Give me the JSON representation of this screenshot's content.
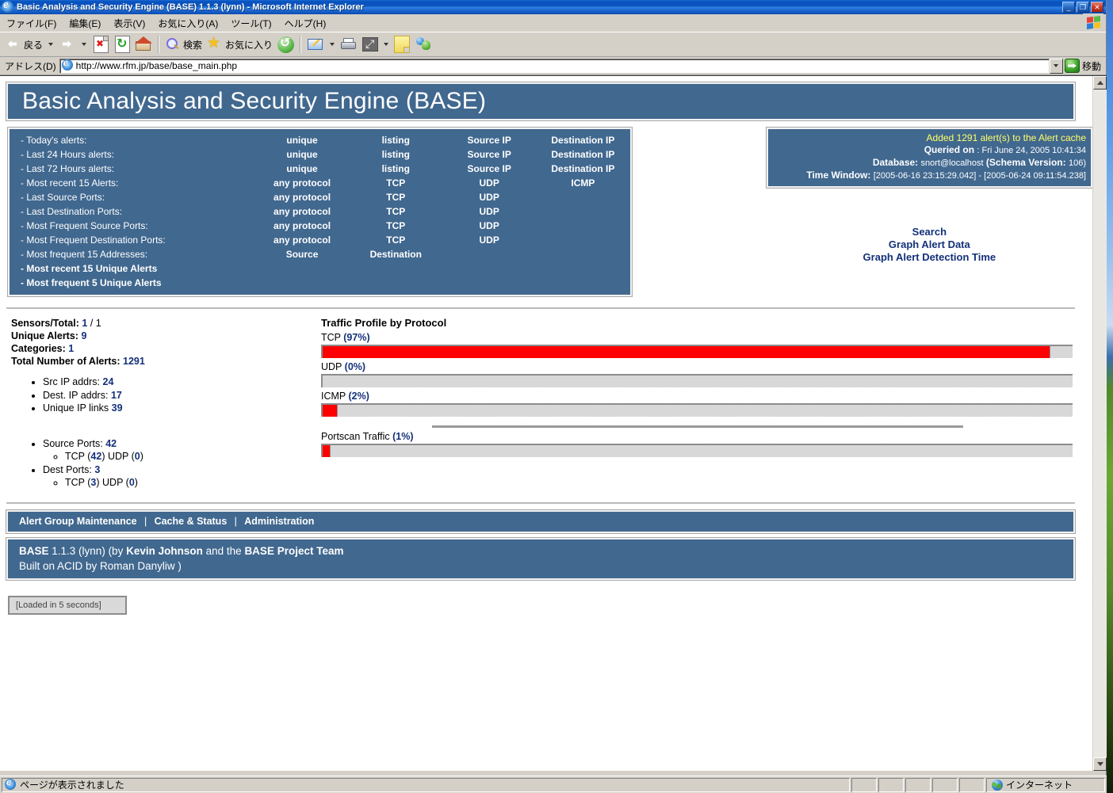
{
  "window": {
    "title": "Basic Analysis and Security Engine (BASE) 1.1.3 (lynn) - Microsoft Internet Explorer",
    "minimize_label": "_",
    "restore_label": "❐",
    "close_label": "✕",
    "app_icon": "ie-logo-icon"
  },
  "menubar": {
    "items": [
      {
        "label": "ファイル(F)"
      },
      {
        "label": "編集(E)"
      },
      {
        "label": "表示(V)"
      },
      {
        "label": "お気に入り(A)"
      },
      {
        "label": "ツール(T)"
      },
      {
        "label": "ヘルプ(H)"
      }
    ],
    "brand_icon": "windows-flag-icon"
  },
  "toolbar": {
    "back_label": "戻る",
    "back_icon": "back-arrow-icon",
    "forward_icon": "forward-arrow-icon",
    "stop_icon": "stop-icon",
    "refresh_icon": "refresh-icon",
    "home_icon": "home-icon",
    "search_label": "検索",
    "search_icon": "search-icon",
    "favorites_label": "お気に入り",
    "favorites_icon": "star-icon",
    "history_icon": "history-icon",
    "mail_icon": "mail-icon",
    "print_icon": "print-icon",
    "edit_icon": "fullscreen-icon",
    "notes_icon": "note-icon",
    "messenger_icon": "messenger-icon"
  },
  "address_bar": {
    "label": "アドレス(D)",
    "url": "http://www.rfm.jp/base/base_main.php",
    "favicon": "ie-page-icon",
    "dropdown_icon": "chevron-down-icon",
    "go_label": "移動",
    "go_icon": "go-arrow-icon"
  },
  "page": {
    "title": "Basic Analysis and Security Engine (BASE)",
    "nav_rows": [
      {
        "label": "- Today's alerts:",
        "c1": "unique",
        "c2": "listing",
        "c3": "Source IP",
        "c4": "Destination IP"
      },
      {
        "label": "- Last 24 Hours alerts:",
        "c1": "unique",
        "c2": "listing",
        "c3": "Source IP",
        "c4": "Destination IP"
      },
      {
        "label": "- Last 72 Hours alerts:",
        "c1": "unique",
        "c2": "listing",
        "c3": "Source IP",
        "c4": "Destination IP"
      },
      {
        "label": "- Most recent 15 Alerts:",
        "c1": "any protocol",
        "c2": "TCP",
        "c3": "UDP",
        "c4": "ICMP"
      },
      {
        "label": "- Last Source Ports:",
        "c1": "any protocol",
        "c2": "TCP",
        "c3": "UDP",
        "c4": ""
      },
      {
        "label": "- Last Destination Ports:",
        "c1": "any protocol",
        "c2": "TCP",
        "c3": "UDP",
        "c4": ""
      },
      {
        "label": "- Most Frequent Source Ports:",
        "c1": "any protocol",
        "c2": "TCP",
        "c3": "UDP",
        "c4": ""
      },
      {
        "label": "- Most Frequent Destination Ports:",
        "c1": "any protocol",
        "c2": "TCP",
        "c3": "UDP",
        "c4": ""
      },
      {
        "label": "- Most frequent 15 Addresses:",
        "c1": "Source",
        "c2": "Destination",
        "c3": "",
        "c4": ""
      }
    ],
    "nav_solo_rows": [
      {
        "label": "- Most recent 15 Unique Alerts"
      },
      {
        "label": "- Most frequent 5 Unique Alerts"
      }
    ],
    "info": {
      "cache_message": "Added 1291 alert(s) to the Alert cache",
      "queried_on_label": "Queried on",
      "queried_on_value": ": Fri June 24, 2005 10:41:34",
      "database_label": "Database:",
      "database_value": "snort@localhost",
      "schema_label": "(Schema Version:",
      "schema_value": "106)",
      "time_window_label": "Time Window:",
      "time_window_value": "[2005-06-16 23:15:29.042] - [2005-06-24 09:11:54.238]"
    },
    "info_links": [
      {
        "label": "Search"
      },
      {
        "label": "Graph Alert Data"
      },
      {
        "label": "Graph Alert Detection Time"
      }
    ],
    "stats": {
      "sensors_label": "Sensors/Total:",
      "sensors_value": "1",
      "sensors_total": "/ 1",
      "unique_alerts_label": "Unique Alerts:",
      "unique_alerts_value": "9",
      "categories_label": "Categories:",
      "categories_value": "1",
      "total_alerts_label": "Total Number of Alerts:",
      "total_alerts_value": "1291",
      "src_ip_label": "Src IP addrs:",
      "src_ip_value": "24",
      "dest_ip_label": "Dest. IP addrs:",
      "dest_ip_value": "17",
      "unique_links_label": "Unique IP links",
      "unique_links_value": "39",
      "source_ports_label": "Source Ports:",
      "source_ports_value": "42",
      "source_ports_tcp_label": "TCP (",
      "source_ports_tcp_value": "42",
      "source_ports_udp_label": ") UDP (",
      "source_ports_udp_value": "0",
      "source_ports_close": ")",
      "dest_ports_label": "Dest Ports:",
      "dest_ports_value": "3",
      "dest_ports_tcp_label": "TCP (",
      "dest_ports_tcp_value": "3",
      "dest_ports_udp_label": ") UDP (",
      "dest_ports_udp_value": "0",
      "dest_ports_close": ")"
    },
    "traffic_title": "Traffic Profile by Protocol",
    "footer_links": [
      {
        "label": "Alert Group Maintenance"
      },
      {
        "label": "Cache & Status"
      },
      {
        "label": "Administration"
      }
    ],
    "footer_separator": "|",
    "credits": {
      "line1_a": "BASE",
      "line1_b": "1.1.3 (lynn) (by",
      "line1_c": "Kevin Johnson",
      "line1_d": "and the",
      "line1_e": "BASE Project Team",
      "line2": "Built on ACID by Roman Danyliw )"
    },
    "loaded_message": "[Loaded in 5 seconds]"
  },
  "chart_data": {
    "type": "bar",
    "title": "Traffic Profile by Protocol",
    "orientation": "horizontal",
    "categories": [
      "TCP",
      "UDP",
      "ICMP",
      "Portscan Traffic"
    ],
    "values": [
      97,
      0,
      2,
      1
    ],
    "unit": "%",
    "xlim": [
      0,
      100
    ],
    "bar_color": "#ff0000",
    "track_color": "#d4d4d4",
    "grid": false,
    "legend": false,
    "labels": [
      {
        "name": "TCP",
        "pct_text": "(97%)",
        "value": 97
      },
      {
        "name": "UDP",
        "pct_text": "(0%)",
        "value": 0
      },
      {
        "name": "ICMP",
        "pct_text": "(2%)",
        "value": 2
      },
      {
        "name": "Portscan Traffic",
        "pct_text": "(1%)",
        "value": 1
      }
    ]
  },
  "statusbar": {
    "message": "ページが表示されました",
    "message_icon": "ie-page-icon",
    "zone_label": "インターネット",
    "zone_icon": "globe-icon"
  },
  "colors": {
    "base_panel": "#41688f",
    "link_blue": "#13307a",
    "bar_red": "#ff0000",
    "highlight_yellow": "#ffff66"
  }
}
